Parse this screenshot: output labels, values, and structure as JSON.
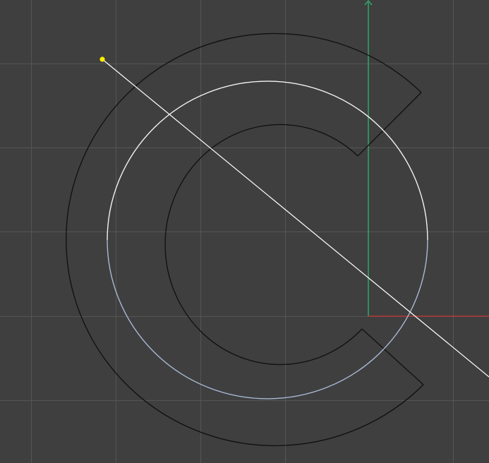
{
  "viewport": {
    "background_color": "#3f3f3f",
    "grid_color": "#555555",
    "grid_visible": true
  },
  "shape": {
    "type": "C-ring",
    "outline_color": "#0f0f0f",
    "selected_circle_color_top": "#f2f2f2",
    "selected_circle_color_bottom": "#a9b9d6"
  },
  "axes": {
    "x_axis_color": "#cc3a3a",
    "y_axis_color": "#2fbf71"
  },
  "tool": {
    "guide_line_color": "#ffffff",
    "handle_color": "#ffee00",
    "handle_icon": "yellow-dot-handle-icon"
  }
}
